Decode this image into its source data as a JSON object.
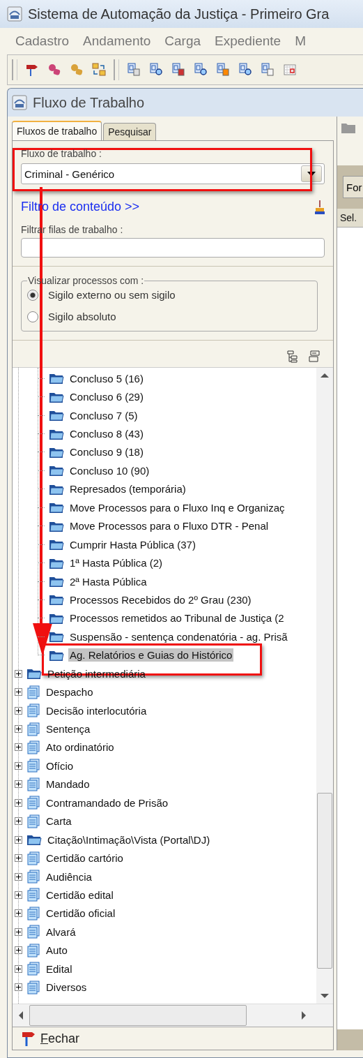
{
  "window": {
    "title": "Sistema de Automação da Justiça - Primeiro Gra"
  },
  "menu": [
    "Cadastro",
    "Andamento",
    "Carga",
    "Expediente",
    "M"
  ],
  "panel": {
    "title": "Fluxo de Trabalho"
  },
  "tabs": [
    {
      "label": "Fluxos de trabalho",
      "selected": true
    },
    {
      "label": "Pesquisar",
      "selected": false
    }
  ],
  "workflow": {
    "label": "Fluxo de trabalho :",
    "value": "Criminal - Genérico"
  },
  "content_filter_link": "Filtro de conteúdo >>",
  "queue_filter": {
    "label": "Filtrar filas de trabalho :"
  },
  "visibility": {
    "legend": "Visualizar processos com :",
    "options": [
      {
        "label": "Sigilo externo ou sem sigilo",
        "selected": true
      },
      {
        "label": "Sigilo absoluto",
        "selected": false
      }
    ]
  },
  "tree": {
    "queues": [
      {
        "label": "Concluso 5 (16)",
        "selected": false
      },
      {
        "label": "Concluso 6 (29)",
        "selected": false
      },
      {
        "label": "Concluso 7 (5)",
        "selected": false
      },
      {
        "label": "Concluso 8 (43)",
        "selected": false
      },
      {
        "label": "Concluso 9 (18)",
        "selected": false
      },
      {
        "label": "Concluso 10 (90)",
        "selected": false
      },
      {
        "label": "Represados (temporária)",
        "selected": false
      },
      {
        "label": "Move Processos para o Fluxo Inq e Organizaç",
        "selected": false
      },
      {
        "label": "Move Processos para o Fluxo DTR - Penal",
        "selected": false
      },
      {
        "label": "Cumprir Hasta Pública (37)",
        "selected": false
      },
      {
        "label": "1ª Hasta Pública (2)",
        "selected": false
      },
      {
        "label": "2ª Hasta Pública",
        "selected": false
      },
      {
        "label": "Processos Recebidos do 2º Grau (230)",
        "selected": false
      },
      {
        "label": "Processos remetidos ao Tribunal de Justiça (2",
        "selected": false
      },
      {
        "label": "Suspensão - sentença condenatória - ag. Prisã",
        "selected": false
      },
      {
        "label": "Ag. Relatórios e Guias do Histórico",
        "selected": true
      }
    ],
    "categories": [
      {
        "label": "Petição intermediária",
        "kind": "folder",
        "expanded": false
      },
      {
        "label": "Despacho",
        "kind": "document",
        "expanded": false
      },
      {
        "label": "Decisão interlocutória",
        "kind": "document",
        "expanded": false
      },
      {
        "label": "Sentença",
        "kind": "document",
        "expanded": false
      },
      {
        "label": "Ato ordinatório",
        "kind": "document",
        "expanded": false
      },
      {
        "label": "Ofício",
        "kind": "document",
        "expanded": false
      },
      {
        "label": "Mandado",
        "kind": "document",
        "expanded": false
      },
      {
        "label": "Contramandado de Prisão",
        "kind": "document",
        "expanded": false
      },
      {
        "label": "Carta",
        "kind": "document",
        "expanded": false
      },
      {
        "label": "Citação\\Intimação\\Vista (Portal\\DJ)",
        "kind": "folder",
        "expanded": false
      },
      {
        "label": "Certidão cartório",
        "kind": "document",
        "expanded": false
      },
      {
        "label": "Audiência",
        "kind": "document",
        "expanded": false
      },
      {
        "label": "Certidão edital",
        "kind": "document",
        "expanded": false
      },
      {
        "label": "Certidão oficial",
        "kind": "document",
        "expanded": false
      },
      {
        "label": "Alvará",
        "kind": "document",
        "expanded": false
      },
      {
        "label": "Auto",
        "kind": "document",
        "expanded": false
      },
      {
        "label": "Edital",
        "kind": "document",
        "expanded": false
      },
      {
        "label": "Diversos",
        "kind": "document",
        "expanded": false
      }
    ]
  },
  "right_pane": {
    "button": "For",
    "column": "Sel."
  },
  "close_button": "Fechar"
}
